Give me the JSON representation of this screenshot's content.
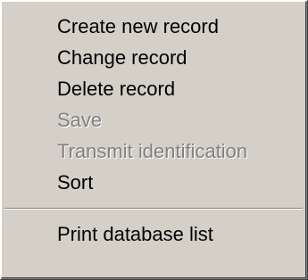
{
  "menu": {
    "items": [
      {
        "label": "Create new record",
        "enabled": true
      },
      {
        "label": "Change record",
        "enabled": true
      },
      {
        "label": "Delete record",
        "enabled": true
      },
      {
        "label": "Save",
        "enabled": false
      },
      {
        "label": "Transmit identification",
        "enabled": false
      },
      {
        "label": "Sort",
        "enabled": true
      },
      {
        "label": "Print database list",
        "enabled": true
      }
    ]
  },
  "colors": {
    "background": "#d4d0c8",
    "text": "#000000",
    "disabled_text": "#808080",
    "highlight": "#ffffff",
    "shadow": "#808080"
  }
}
